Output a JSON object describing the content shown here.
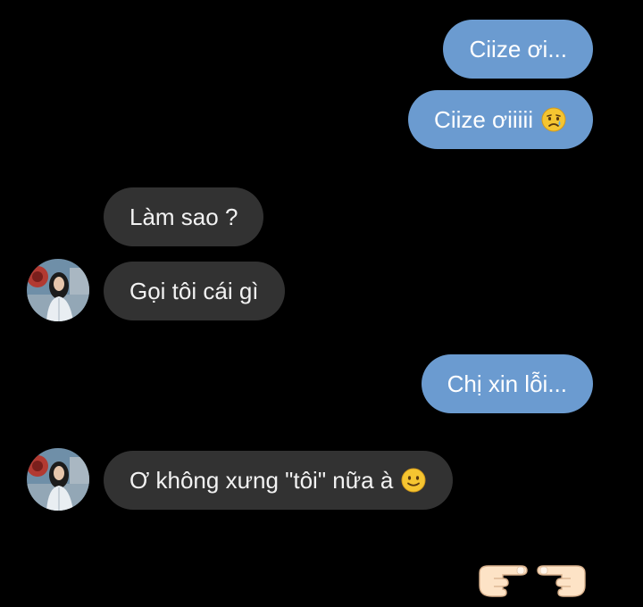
{
  "conversation": {
    "messages": [
      {
        "direction": "outgoing",
        "text": "Ciize ơi..."
      },
      {
        "direction": "outgoing",
        "text": "Ciize ơiiiii",
        "emoji": "sad-tear-face"
      },
      {
        "direction": "incoming",
        "text": "Làm sao ?"
      },
      {
        "direction": "incoming",
        "text": "Gọi tôi cái gì"
      },
      {
        "direction": "outgoing",
        "text": "Chị xin lỗi..."
      },
      {
        "direction": "incoming",
        "text": "Ơ không xưng \"tôi\" nữa à",
        "emoji": "slightly-smiling-face"
      }
    ],
    "reaction": [
      "pointing-right-hand",
      "pointing-left-hand"
    ]
  },
  "colors": {
    "background": "#000000",
    "outgoing_bubble": "#6b9bd0",
    "incoming_bubble": "#323232",
    "text": "#ffffff"
  }
}
